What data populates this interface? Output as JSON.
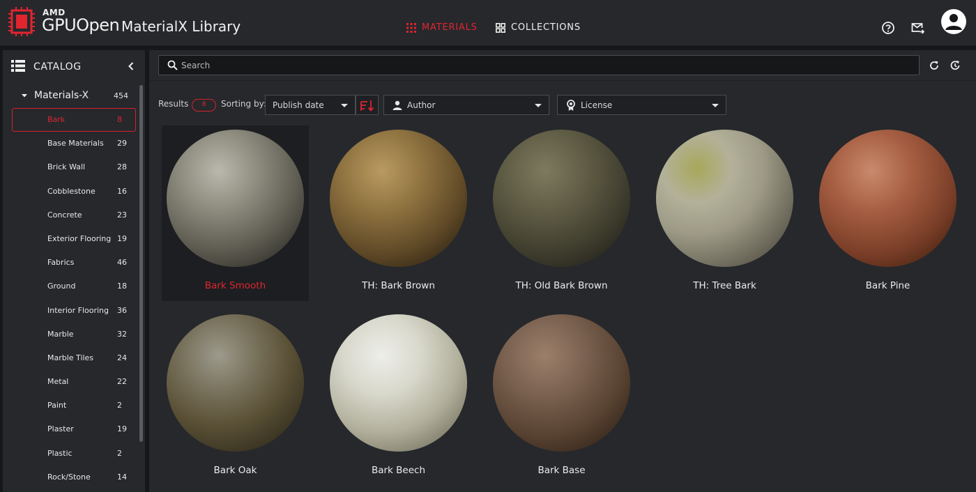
{
  "header": {
    "brand_small": "AMD",
    "brand_large": "GPUOpen",
    "app_title": "MaterialX Library",
    "nav": [
      {
        "label": "MATERIALS",
        "icon": "grid-dots-icon",
        "active": true
      },
      {
        "label": "COLLECTIONS",
        "icon": "collections-grid-icon",
        "active": false
      }
    ],
    "icons": [
      "help-circle-icon",
      "mail-forward-icon",
      "account-icon"
    ],
    "accent_color": "#e0252f"
  },
  "sidebar": {
    "title": "CATALOG",
    "group": {
      "label": "Materials-X",
      "count": "454",
      "expanded": true
    },
    "items": [
      {
        "label": "Bark",
        "count": "8",
        "selected": true
      },
      {
        "label": "Base Materials",
        "count": "29"
      },
      {
        "label": "Brick Wall",
        "count": "28"
      },
      {
        "label": "Cobblestone",
        "count": "16"
      },
      {
        "label": "Concrete",
        "count": "23"
      },
      {
        "label": "Exterior Flooring",
        "count": "19"
      },
      {
        "label": "Fabrics",
        "count": "46"
      },
      {
        "label": "Ground",
        "count": "18"
      },
      {
        "label": "Interior Flooring",
        "count": "36"
      },
      {
        "label": "Marble",
        "count": "32"
      },
      {
        "label": "Marble Tiles",
        "count": "24"
      },
      {
        "label": "Metal",
        "count": "22"
      },
      {
        "label": "Paint",
        "count": "2"
      },
      {
        "label": "Plaster",
        "count": "19"
      },
      {
        "label": "Plastic",
        "count": "2"
      },
      {
        "label": "Rock/Stone",
        "count": "14"
      }
    ]
  },
  "search": {
    "placeholder": "Search",
    "value": ""
  },
  "filters": {
    "results_label": "Results",
    "results_count": "8",
    "sorting_label": "Sorting by:",
    "sort_value": "Publish date",
    "author_value": "Author",
    "license_value": "License"
  },
  "materials": [
    {
      "name": "Bark Smooth",
      "active": true
    },
    {
      "name": "TH: Bark Brown"
    },
    {
      "name": "TH: Old Bark Brown"
    },
    {
      "name": "TH: Tree Bark"
    },
    {
      "name": "Bark Pine"
    },
    {
      "name": "Bark Oak"
    },
    {
      "name": "Bark Beech"
    },
    {
      "name": "Bark Base"
    }
  ]
}
